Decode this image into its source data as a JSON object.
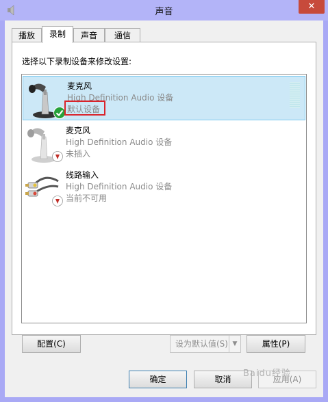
{
  "window": {
    "title": "声音",
    "close_glyph": "✕"
  },
  "tabs": [
    {
      "label": "播放"
    },
    {
      "label": "录制",
      "active": true
    },
    {
      "label": "声音"
    },
    {
      "label": "通信"
    }
  ],
  "panel": {
    "instruction": "选择以下录制设备来修改设置:"
  },
  "devices": [
    {
      "name": "麦克风",
      "driver": "High Definition Audio 设备",
      "status": "默认设备",
      "icon": "microphone-icon",
      "badge": "green-check-badge",
      "selected": true
    },
    {
      "name": "麦克风",
      "driver": "High Definition Audio 设备",
      "status": "未插入",
      "icon": "microphone-icon",
      "badge": "unplugged-badge",
      "selected": false
    },
    {
      "name": "线路输入",
      "driver": "High Definition Audio 设备",
      "status": "当前不可用",
      "icon": "rca-cable-icon",
      "badge": "unplugged-badge",
      "selected": false
    }
  ],
  "buttons": {
    "configure": "配置(C)",
    "set_default": "设为默认值(S)",
    "properties": "属性(P)",
    "ok": "确定",
    "cancel": "取消",
    "apply": "应用(A)"
  },
  "watermark": "Baidu经验",
  "colors": {
    "title_bar": "#b3b4f8",
    "selection": "#cce8f7",
    "highlight_box": "#d9242b",
    "check_badge": "#27a13a",
    "unplugged_badge": "#c0302a"
  }
}
